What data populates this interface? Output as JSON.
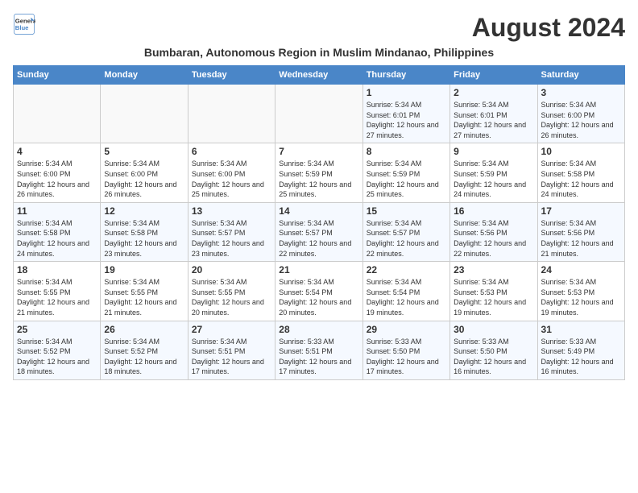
{
  "header": {
    "logo_line1": "General",
    "logo_line2": "Blue",
    "title": "August 2024",
    "subtitle": "Bumbaran, Autonomous Region in Muslim Mindanao, Philippines"
  },
  "days_of_week": [
    "Sunday",
    "Monday",
    "Tuesday",
    "Wednesday",
    "Thursday",
    "Friday",
    "Saturday"
  ],
  "weeks": [
    [
      {
        "day": "",
        "info": ""
      },
      {
        "day": "",
        "info": ""
      },
      {
        "day": "",
        "info": ""
      },
      {
        "day": "",
        "info": ""
      },
      {
        "day": "1",
        "info": "Sunrise: 5:34 AM\nSunset: 6:01 PM\nDaylight: 12 hours and 27 minutes."
      },
      {
        "day": "2",
        "info": "Sunrise: 5:34 AM\nSunset: 6:01 PM\nDaylight: 12 hours and 27 minutes."
      },
      {
        "day": "3",
        "info": "Sunrise: 5:34 AM\nSunset: 6:00 PM\nDaylight: 12 hours and 26 minutes."
      }
    ],
    [
      {
        "day": "4",
        "info": "Sunrise: 5:34 AM\nSunset: 6:00 PM\nDaylight: 12 hours and 26 minutes."
      },
      {
        "day": "5",
        "info": "Sunrise: 5:34 AM\nSunset: 6:00 PM\nDaylight: 12 hours and 26 minutes."
      },
      {
        "day": "6",
        "info": "Sunrise: 5:34 AM\nSunset: 6:00 PM\nDaylight: 12 hours and 25 minutes."
      },
      {
        "day": "7",
        "info": "Sunrise: 5:34 AM\nSunset: 5:59 PM\nDaylight: 12 hours and 25 minutes."
      },
      {
        "day": "8",
        "info": "Sunrise: 5:34 AM\nSunset: 5:59 PM\nDaylight: 12 hours and 25 minutes."
      },
      {
        "day": "9",
        "info": "Sunrise: 5:34 AM\nSunset: 5:59 PM\nDaylight: 12 hours and 24 minutes."
      },
      {
        "day": "10",
        "info": "Sunrise: 5:34 AM\nSunset: 5:58 PM\nDaylight: 12 hours and 24 minutes."
      }
    ],
    [
      {
        "day": "11",
        "info": "Sunrise: 5:34 AM\nSunset: 5:58 PM\nDaylight: 12 hours and 24 minutes."
      },
      {
        "day": "12",
        "info": "Sunrise: 5:34 AM\nSunset: 5:58 PM\nDaylight: 12 hours and 23 minutes."
      },
      {
        "day": "13",
        "info": "Sunrise: 5:34 AM\nSunset: 5:57 PM\nDaylight: 12 hours and 23 minutes."
      },
      {
        "day": "14",
        "info": "Sunrise: 5:34 AM\nSunset: 5:57 PM\nDaylight: 12 hours and 22 minutes."
      },
      {
        "day": "15",
        "info": "Sunrise: 5:34 AM\nSunset: 5:57 PM\nDaylight: 12 hours and 22 minutes."
      },
      {
        "day": "16",
        "info": "Sunrise: 5:34 AM\nSunset: 5:56 PM\nDaylight: 12 hours and 22 minutes."
      },
      {
        "day": "17",
        "info": "Sunrise: 5:34 AM\nSunset: 5:56 PM\nDaylight: 12 hours and 21 minutes."
      }
    ],
    [
      {
        "day": "18",
        "info": "Sunrise: 5:34 AM\nSunset: 5:55 PM\nDaylight: 12 hours and 21 minutes."
      },
      {
        "day": "19",
        "info": "Sunrise: 5:34 AM\nSunset: 5:55 PM\nDaylight: 12 hours and 21 minutes."
      },
      {
        "day": "20",
        "info": "Sunrise: 5:34 AM\nSunset: 5:55 PM\nDaylight: 12 hours and 20 minutes."
      },
      {
        "day": "21",
        "info": "Sunrise: 5:34 AM\nSunset: 5:54 PM\nDaylight: 12 hours and 20 minutes."
      },
      {
        "day": "22",
        "info": "Sunrise: 5:34 AM\nSunset: 5:54 PM\nDaylight: 12 hours and 19 minutes."
      },
      {
        "day": "23",
        "info": "Sunrise: 5:34 AM\nSunset: 5:53 PM\nDaylight: 12 hours and 19 minutes."
      },
      {
        "day": "24",
        "info": "Sunrise: 5:34 AM\nSunset: 5:53 PM\nDaylight: 12 hours and 19 minutes."
      }
    ],
    [
      {
        "day": "25",
        "info": "Sunrise: 5:34 AM\nSunset: 5:52 PM\nDaylight: 12 hours and 18 minutes."
      },
      {
        "day": "26",
        "info": "Sunrise: 5:34 AM\nSunset: 5:52 PM\nDaylight: 12 hours and 18 minutes."
      },
      {
        "day": "27",
        "info": "Sunrise: 5:34 AM\nSunset: 5:51 PM\nDaylight: 12 hours and 17 minutes."
      },
      {
        "day": "28",
        "info": "Sunrise: 5:33 AM\nSunset: 5:51 PM\nDaylight: 12 hours and 17 minutes."
      },
      {
        "day": "29",
        "info": "Sunrise: 5:33 AM\nSunset: 5:50 PM\nDaylight: 12 hours and 17 minutes."
      },
      {
        "day": "30",
        "info": "Sunrise: 5:33 AM\nSunset: 5:50 PM\nDaylight: 12 hours and 16 minutes."
      },
      {
        "day": "31",
        "info": "Sunrise: 5:33 AM\nSunset: 5:49 PM\nDaylight: 12 hours and 16 minutes."
      }
    ]
  ]
}
